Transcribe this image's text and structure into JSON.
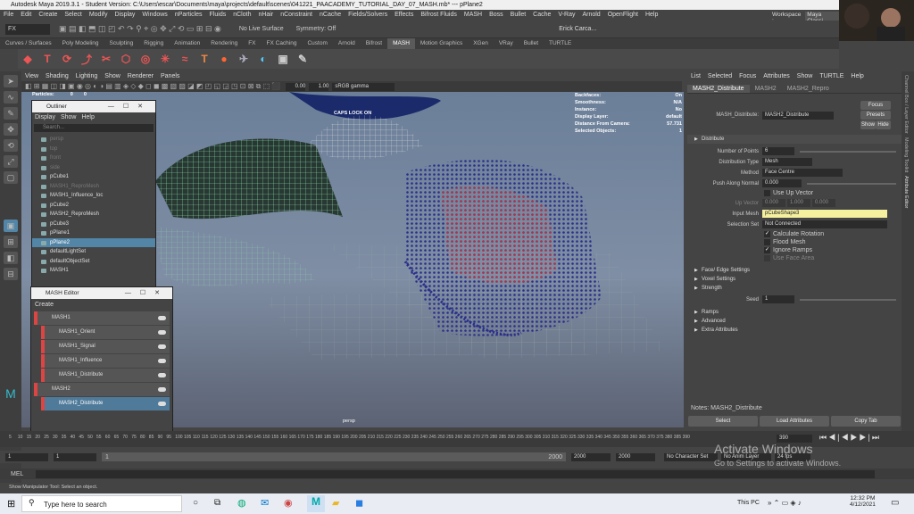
{
  "title": "Autodesk Maya 2019.3.1 - Student Version: C:\\Users\\escar\\Documents\\maya\\projects\\default\\scenes\\041221_PAACADEMY_TUTORIAL_DAY_07_MASH.mb* --- pPlane2",
  "menus": [
    "File",
    "Edit",
    "Create",
    "Select",
    "Modify",
    "Display",
    "Windows",
    "nParticles",
    "Fluids",
    "nCloth",
    "nHair",
    "nConstraint",
    "nCache",
    "Fields/Solvers",
    "Effects",
    "Bifrost Fluids",
    "MASH",
    "Boss",
    "Bullet",
    "Cache",
    "V-Ray",
    "Arnold",
    "OpenFlight",
    "Help"
  ],
  "workspace": {
    "label": "Workspace :",
    "value": "Maya Classi"
  },
  "status": {
    "mode": "FX",
    "live_surface": "No Live Surface",
    "symmetry": "Symmetry: Off",
    "user": "Erick Carca..."
  },
  "shelf_tabs": [
    "Curves / Surfaces",
    "Poly Modeling",
    "Sculpting",
    "Rigging",
    "Animation",
    "Rendering",
    "FX",
    "FX Caching",
    "Custom",
    "Arnold",
    "Bifrost",
    "MASH",
    "Motion Graphics",
    "XGen",
    "VRay",
    "Bullet",
    "TURTLE"
  ],
  "shelf_active": "MASH",
  "panel_menu": [
    "View",
    "Shading",
    "Lighting",
    "Show",
    "Renderer",
    "Panels"
  ],
  "panel_tool": {
    "exposure": "0.00",
    "gamma": "1.00",
    "colorspace": "sRGB gamma"
  },
  "viewport": {
    "particles_label": "Particles:",
    "particles_a": "0",
    "particles_b": "0",
    "caps": "CAPS LOCK ON",
    "camera": "persp",
    "hud": [
      {
        "k": "Backfaces:",
        "v": "On"
      },
      {
        "k": "Smoothness:",
        "v": "N/A"
      },
      {
        "k": "Instance:",
        "v": "No"
      },
      {
        "k": "Display Layer:",
        "v": "default"
      },
      {
        "k": "Distance From Camera:",
        "v": "57.731"
      },
      {
        "k": "Selected Objects:",
        "v": "1"
      }
    ]
  },
  "outliner": {
    "title": "Outliner",
    "menu": [
      "Display",
      "Show",
      "Help"
    ],
    "search": "Search...",
    "items": [
      {
        "label": "persp",
        "dim": true
      },
      {
        "label": "top",
        "dim": true
      },
      {
        "label": "front",
        "dim": true
      },
      {
        "label": "side",
        "dim": true
      },
      {
        "label": "pCube1",
        "dim": false
      },
      {
        "label": "MASH1_ReproMesh",
        "dim": true
      },
      {
        "label": "MASH1_Influence_loc",
        "dim": false
      },
      {
        "label": "pCube2",
        "dim": false
      },
      {
        "label": "MASH2_ReproMesh",
        "dim": false
      },
      {
        "label": "pCube3",
        "dim": false
      },
      {
        "label": "pPlane1",
        "dim": false
      },
      {
        "label": "pPlane2",
        "dim": false,
        "sel": true
      },
      {
        "label": "defaultLightSet",
        "dim": false
      },
      {
        "label": "defaultObjectSet",
        "dim": false
      },
      {
        "label": "MASH1",
        "dim": false
      }
    ]
  },
  "mash_editor": {
    "title": "MASH Editor",
    "create": "Create",
    "rows": [
      {
        "label": "MASH1",
        "indent": 0,
        "sel": false
      },
      {
        "label": "MASH1_Orient",
        "indent": 1,
        "sel": false
      },
      {
        "label": "MASH1_Signal",
        "indent": 1,
        "sel": false
      },
      {
        "label": "MASH1_Influence",
        "indent": 1,
        "sel": false
      },
      {
        "label": "MASH1_Distribute",
        "indent": 1,
        "sel": false
      },
      {
        "label": "MASH2",
        "indent": 0,
        "sel": false
      },
      {
        "label": "MASH2_Distribute",
        "indent": 1,
        "sel": true
      }
    ]
  },
  "attr": {
    "menu": [
      "List",
      "Selected",
      "Focus",
      "Attributes",
      "Show",
      "TURTLE",
      "Help"
    ],
    "tabs": [
      "MASH2_Distribute",
      "MASH2",
      "MASH2_Repro"
    ],
    "node_label": "MASH_Distribute:",
    "node_value": "MASH2_Distribute",
    "btn_focus": "Focus",
    "btn_presets": "Presets",
    "btn_show": "Show",
    "btn_hide": "Hide",
    "section": "Distribute",
    "num_points_label": "Number of Points",
    "num_points": "6",
    "dist_type_label": "Distribution Type",
    "dist_type": "Mesh",
    "method_label": "Method",
    "method": "Face Centre",
    "push_label": "Push Along Normal",
    "push": "0.000",
    "upvec_check": "Use Up Vector",
    "upvec_label": "Up Vector",
    "upvec": [
      "0.000",
      "1.000",
      "0.000"
    ],
    "input_mesh_label": "Input Mesh",
    "input_mesh": "pCubeShape3",
    "sel_set_label": "Selection Set",
    "sel_set": "Not Connected",
    "checks": [
      {
        "label": "Calculate Rotation",
        "on": true
      },
      {
        "label": "Flood Mesh",
        "on": false
      },
      {
        "label": "Ignore Ramps",
        "on": true
      },
      {
        "label": "Use Face Area",
        "on": false
      }
    ],
    "subsections": [
      "Face/ Edge Settings",
      "Voxel Settings",
      "Strength"
    ],
    "seed_label": "Seed",
    "seed": "1",
    "subsections2": [
      "Ramps",
      "Advanced",
      "Extra Attributes"
    ],
    "notes": "Notes:  MASH2_Distribute",
    "footer": [
      "Select",
      "Load Attributes",
      "Copy Tab"
    ]
  },
  "right_strip": [
    "Channel Box / Layer Editor",
    "Modeling Toolkit",
    "Attribute Editor"
  ],
  "timeline": {
    "ticks": [
      "5",
      "10",
      "15",
      "20",
      "25",
      "30",
      "35",
      "40",
      "45",
      "50",
      "55",
      "60",
      "65",
      "70",
      "75",
      "80",
      "85",
      "90",
      "95",
      "100",
      "105",
      "110",
      "115",
      "120",
      "125",
      "130",
      "135",
      "140",
      "145",
      "150",
      "155",
      "160",
      "165",
      "170",
      "175",
      "180",
      "185",
      "190",
      "195",
      "200",
      "205",
      "210",
      "215",
      "220",
      "225",
      "230",
      "235",
      "240",
      "245",
      "250",
      "255",
      "260",
      "265",
      "270",
      "275",
      "280",
      "285",
      "290",
      "295",
      "300",
      "305",
      "310",
      "315",
      "320",
      "325",
      "330",
      "335",
      "340",
      "345",
      "350",
      "355",
      "360",
      "365",
      "370",
      "375",
      "380",
      "385",
      "390"
    ],
    "current": "390"
  },
  "range": {
    "start": "1",
    "start2": "1",
    "a": "1",
    "b": "2000",
    "c": "2000",
    "d": "2000",
    "char": "No Character Set",
    "anim": "No Anim Layer",
    "fps": "24 fps"
  },
  "cmd": {
    "label": "MEL"
  },
  "helpline": "Show Manipulator Tool: Select an object.",
  "activate": {
    "line1": "Activate Windows",
    "line2": "Go to Settings to activate Windows."
  },
  "taskbar": {
    "search": "Type here to search",
    "this_pc": "This PC",
    "time": "12:32 PM",
    "date": "4/12/2021"
  }
}
